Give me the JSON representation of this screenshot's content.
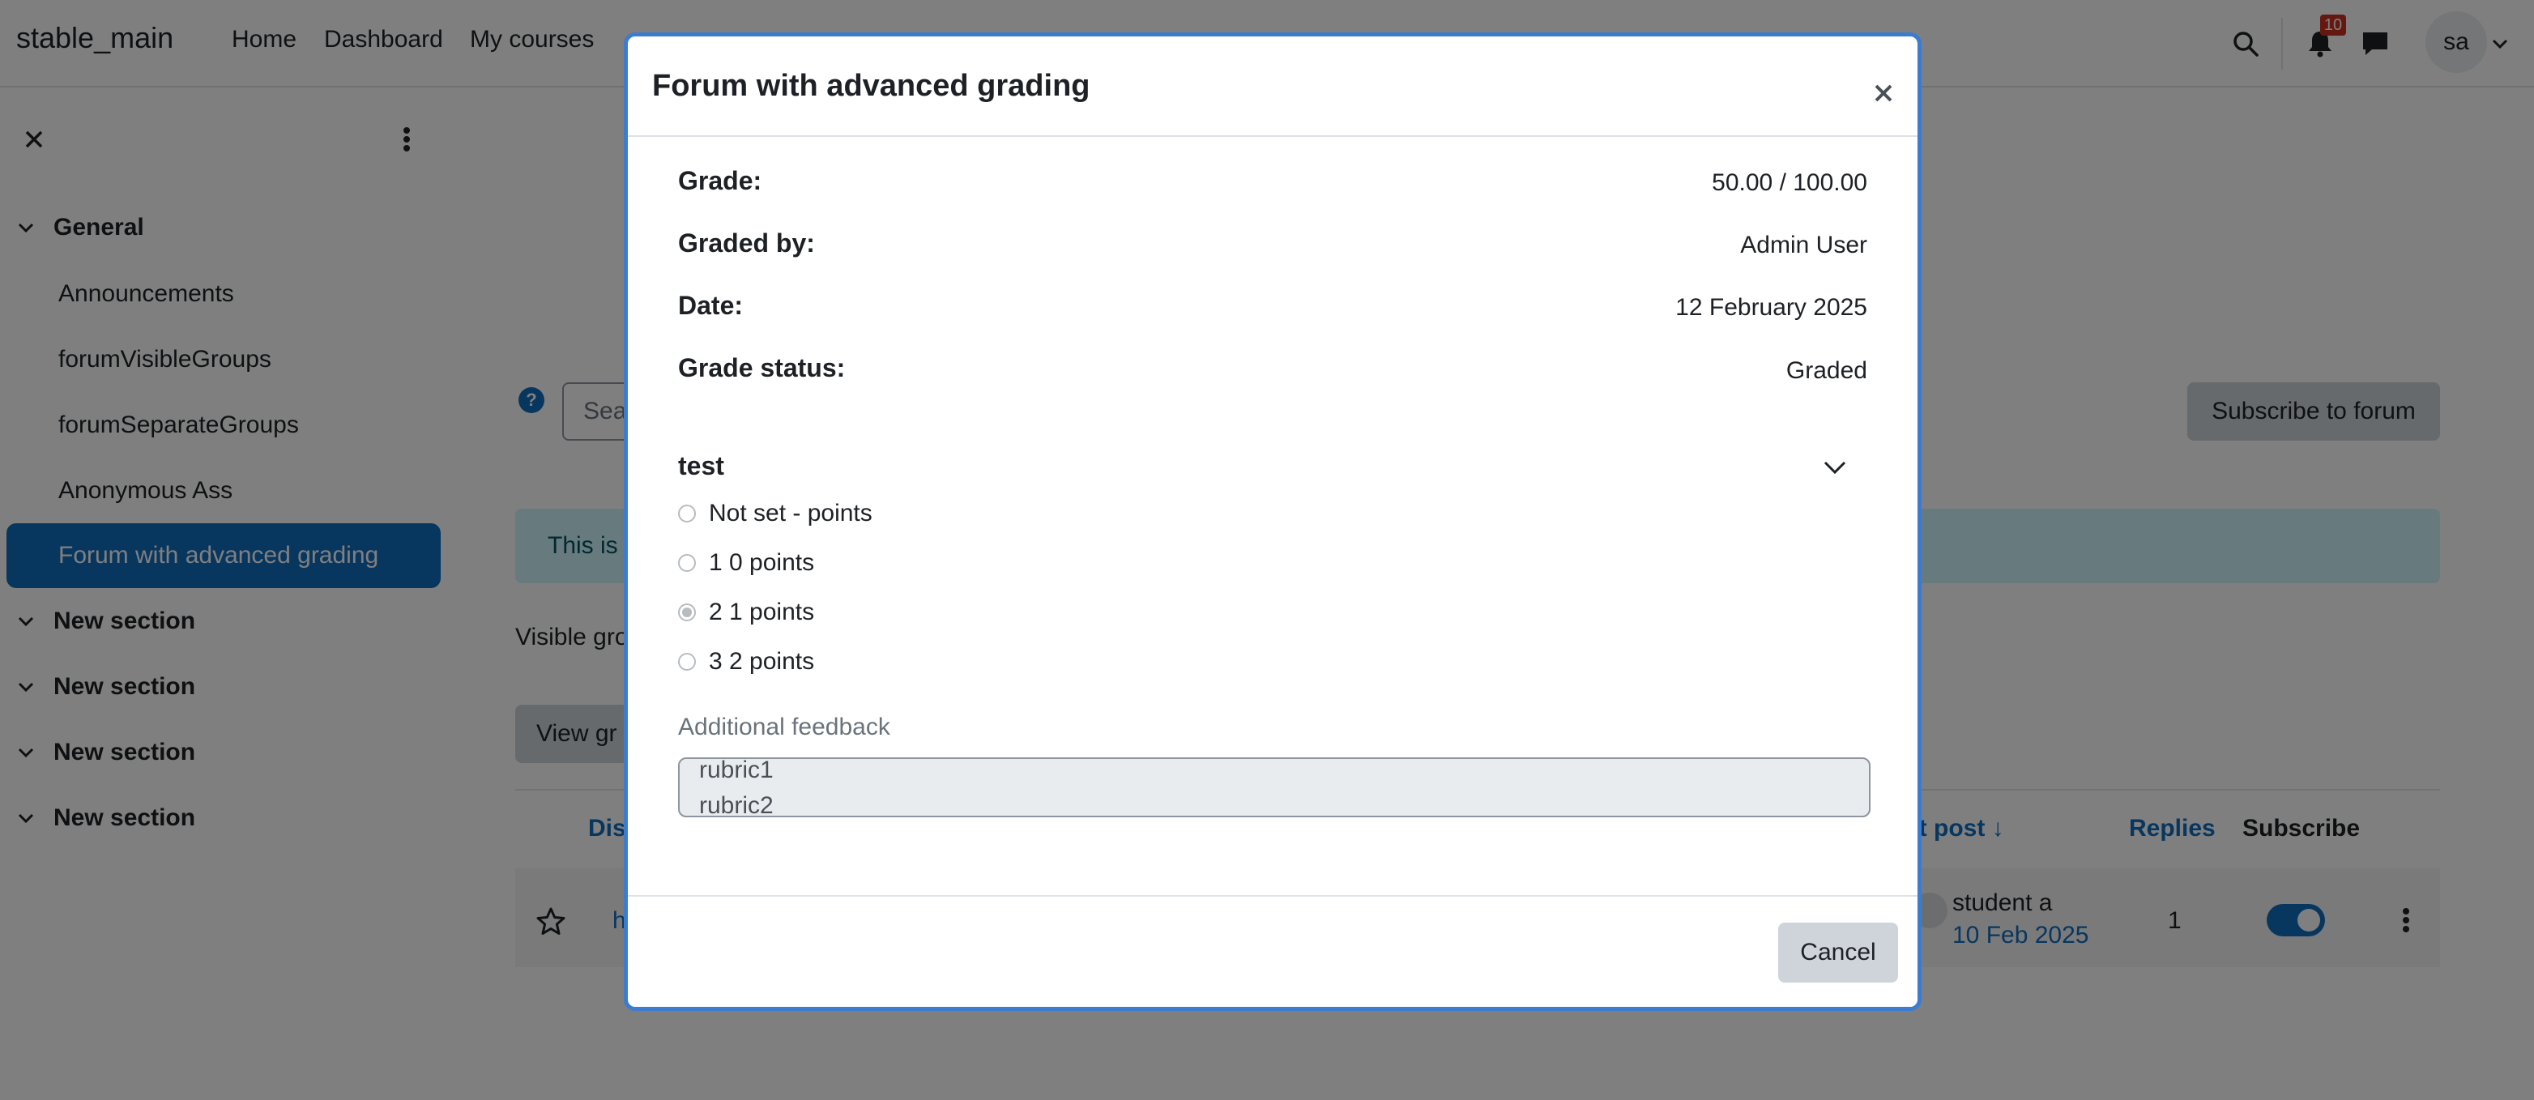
{
  "navbar": {
    "site_name": "stable_main",
    "links": [
      "Home",
      "Dashboard",
      "My courses"
    ],
    "notification_count": "10",
    "user_initials": "sa"
  },
  "drawer": {
    "sections": [
      {
        "name": "General",
        "items": [
          "Announcements",
          "forumVisibleGroups",
          "forumSeparateGroups",
          "Anonymous Ass",
          "Forum with advanced grading"
        ],
        "active_item": "Forum with advanced grading"
      },
      {
        "name": "New section",
        "items": []
      },
      {
        "name": "New section",
        "items": []
      },
      {
        "name": "New section",
        "items": []
      },
      {
        "name": "New section",
        "items": []
      }
    ]
  },
  "page": {
    "help_glyph": "?",
    "search_placeholder": "Sea",
    "subscribe_button": "Subscribe to forum",
    "info_text": "This is",
    "visible_groups_text": "Visible gro",
    "view_button": "View gr",
    "table": {
      "headers": {
        "discussion": "Disc",
        "last_post": "st post ↓",
        "replies": "Replies",
        "subscribe": "Subscribe"
      },
      "rows": [
        {
          "title": "h",
          "author": "student a",
          "date": "10 Feb 2025",
          "replies": "1",
          "subscribed": true
        }
      ]
    }
  },
  "modal": {
    "title": "Forum with advanced grading",
    "summary": [
      {
        "label": "Grade:",
        "value": "50.00 / 100.00"
      },
      {
        "label": "Graded by:",
        "value": "Admin User"
      },
      {
        "label": "Date:",
        "value": "12 February 2025"
      },
      {
        "label": "Grade status:",
        "value": "Graded"
      }
    ],
    "criterion": {
      "name": "test",
      "levels": [
        "Not set - points",
        "1 0 points",
        "2 1 points",
        "3 2 points"
      ],
      "selected_level": "2 1 points"
    },
    "feedback_label": "Additional feedback",
    "feedback_lines": [
      "rubric1",
      "rubric2"
    ],
    "cancel_button": "Cancel"
  },
  "colors": {
    "brand_primary": "#0f6cbf",
    "modal_border": "#3b7bd0",
    "badge": "#ca3120"
  },
  "icons": [
    "search-icon",
    "bell-icon",
    "chat-icon",
    "chevron-down-icon",
    "close-icon",
    "kebab-icon",
    "star-icon",
    "help-icon"
  ]
}
